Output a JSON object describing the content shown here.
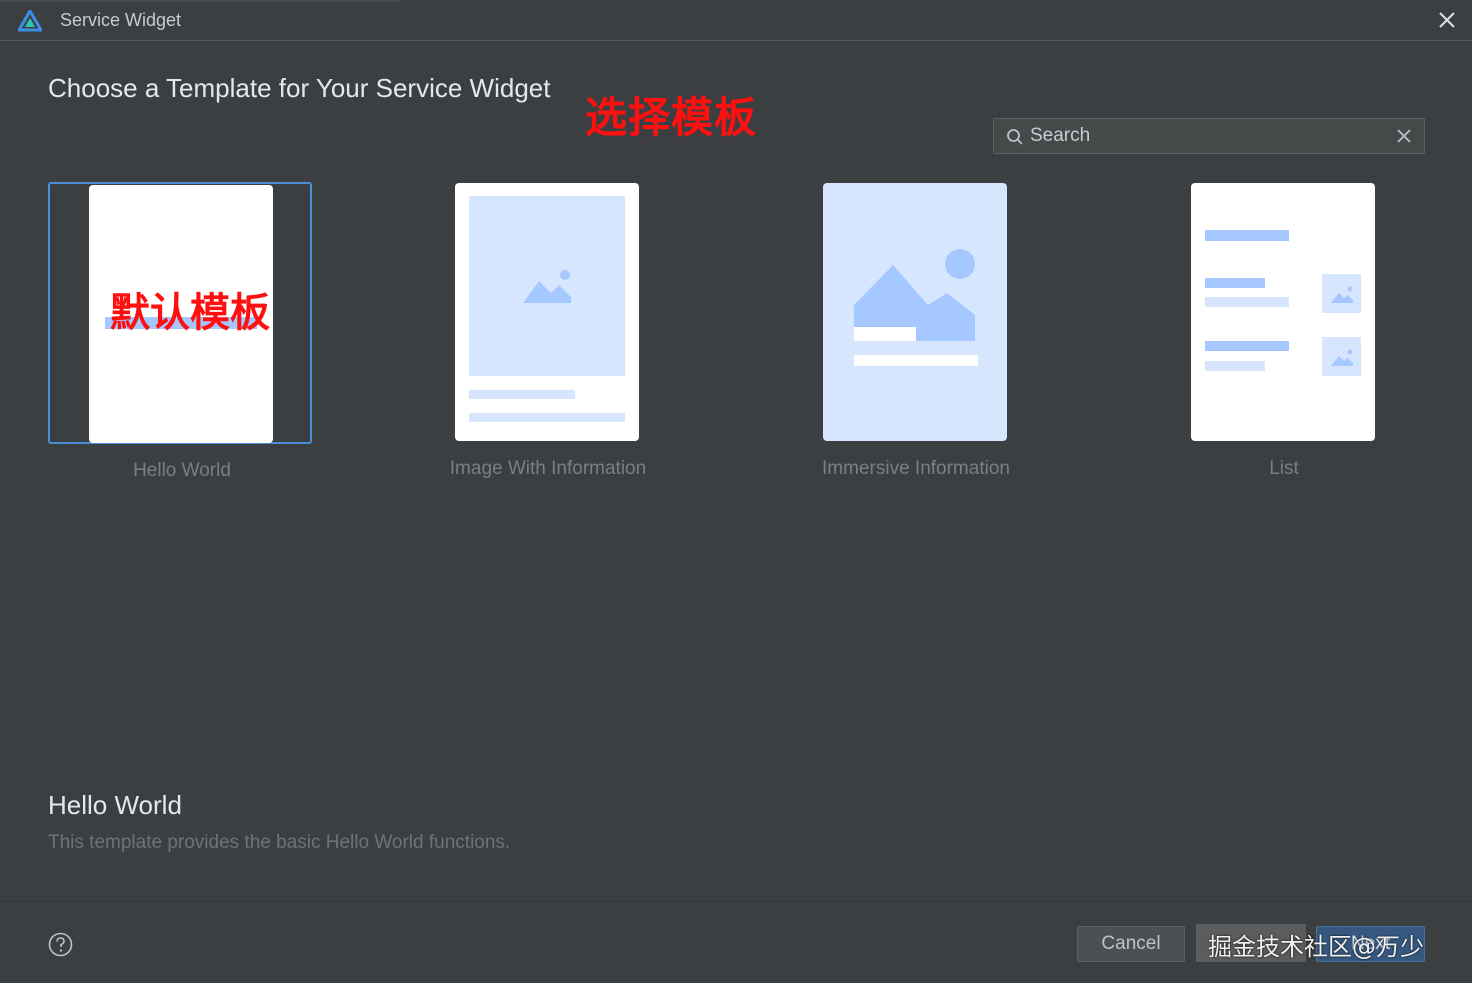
{
  "window": {
    "title": "Service Widget",
    "app_icon": "deveco-logo-icon",
    "close_icon": "close-icon"
  },
  "heading": "Choose a Template for Your Service Widget",
  "annotations": {
    "top": "选择模板",
    "card": "默认模板"
  },
  "search": {
    "placeholder": "Search",
    "value": "",
    "icon": "search-icon",
    "clear_icon": "close-icon"
  },
  "templates": [
    {
      "label": "Hello World",
      "selected": true
    },
    {
      "label": "Image With Information",
      "selected": false
    },
    {
      "label": "Immersive Information",
      "selected": false
    },
    {
      "label": "List",
      "selected": false
    }
  ],
  "description": {
    "title": "Hello World",
    "text": "This template provides the basic Hello World functions."
  },
  "footer": {
    "help_icon": "help-icon",
    "cancel_label": "Cancel",
    "next_label": "Next",
    "watermark": "掘金技术社区@万少"
  },
  "colors": {
    "background": "#3c3f41",
    "selection_border": "#4b8fd7",
    "thumbnail_accent": "#a4c8ff",
    "thumbnail_fill": "#d7e6ff",
    "primary_button": "#365880",
    "annotation": "#ff1010"
  }
}
